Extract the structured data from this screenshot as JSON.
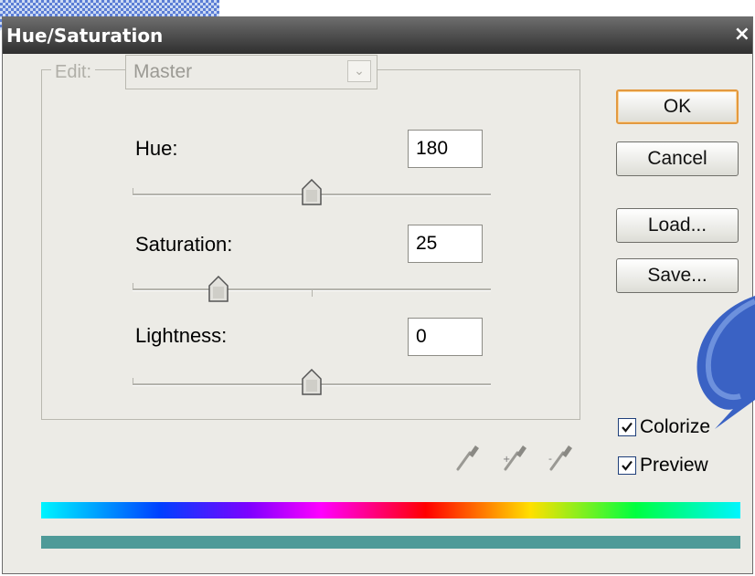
{
  "dialog": {
    "title": "Hue/Saturation",
    "close_glyph": "×"
  },
  "edit": {
    "label": "Edit:",
    "value": "Master",
    "arrow_glyph": "⌄"
  },
  "sliders": {
    "hue": {
      "label": "Hue:",
      "value": "180",
      "fraction": 0.5
    },
    "saturation": {
      "label": "Saturation:",
      "value": "25",
      "fraction": 0.24
    },
    "lightness": {
      "label": "Lightness:",
      "value": "0",
      "fraction": 0.5
    }
  },
  "buttons": {
    "ok": "OK",
    "cancel": "Cancel",
    "load": "Load...",
    "save": "Save..."
  },
  "checkboxes": {
    "colorize": {
      "label": "Colorize",
      "checked": true
    },
    "preview": {
      "label": "Preview",
      "checked": true
    }
  },
  "colors": {
    "result_bar": "#4f9a98",
    "callout_fill": "#3a62c4"
  },
  "icons": [
    "eyedropper-icon",
    "eyedropper-plus-icon",
    "eyedropper-minus-icon",
    "slider-thumb-icon",
    "checkmark-icon",
    "chevron-down-icon",
    "close-icon"
  ]
}
